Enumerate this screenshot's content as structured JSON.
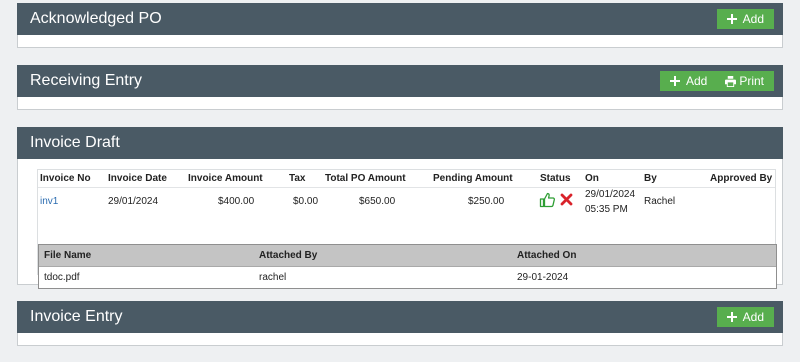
{
  "acknowledged_po": {
    "title": "Acknowledged PO",
    "add_label": "Add"
  },
  "receiving_entry": {
    "title": "Receiving Entry",
    "add_label": "Add",
    "print_label": "Print"
  },
  "invoice_draft": {
    "title": "Invoice Draft",
    "columns": {
      "invoice_no": "Invoice No",
      "invoice_date": "Invoice Date",
      "invoice_amount": "Invoice Amount",
      "tax": "Tax",
      "total_po_amount": "Total PO Amount",
      "pending_amount": "Pending Amount",
      "status": "Status",
      "on": "On",
      "by": "By",
      "approved_by": "Approved By"
    },
    "row": {
      "invoice_no": "inv1",
      "invoice_date": "29/01/2024",
      "invoice_amount": "$400.00",
      "tax": "$0.00",
      "total_po_amount": "$650.00",
      "pending_amount": "$250.00",
      "on_date": "29/01/2024",
      "on_time": "05:35 PM",
      "by": "Rachel",
      "approved_by": ""
    },
    "attachments": {
      "columns": {
        "file_name": "File Name",
        "attached_by": "Attached By",
        "attached_on": "Attached On"
      },
      "rows": [
        {
          "file_name": "tdoc.pdf",
          "attached_by": "rachel",
          "attached_on": "29-01-2024"
        }
      ]
    }
  },
  "invoice_entry": {
    "title": "Invoice Entry",
    "add_label": "Add"
  },
  "colors": {
    "header_bg": "#4a5a65",
    "button_green": "#58ae4e",
    "approve_green": "#2e9e34",
    "reject_red": "#d9232b",
    "link_blue": "#2b6cb0"
  }
}
